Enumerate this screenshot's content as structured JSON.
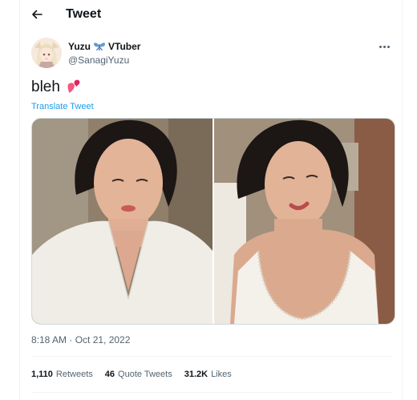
{
  "header": {
    "title": "Tweet"
  },
  "author": {
    "display_name": "Yuzu",
    "display_name_suffix": "VTuber",
    "handle": "@SanagiYuzu",
    "name_icon": "butterfly-icon"
  },
  "tweet": {
    "text": "bleh",
    "emoji_icon": "two-hearts-icon",
    "translate_label": "Translate Tweet",
    "timestamp": "8:18 AM · Oct 21, 2022"
  },
  "media": {
    "count": 2
  },
  "stats": {
    "retweets_count": "1,110",
    "retweets_label": "Retweets",
    "quotes_count": "46",
    "quotes_label": "Quote Tweets",
    "likes_count": "31.2K",
    "likes_label": "Likes"
  },
  "colors": {
    "accent": "#1d9bf0",
    "text": "#0f1419",
    "secondary": "#536471",
    "border": "#eff3f4"
  }
}
